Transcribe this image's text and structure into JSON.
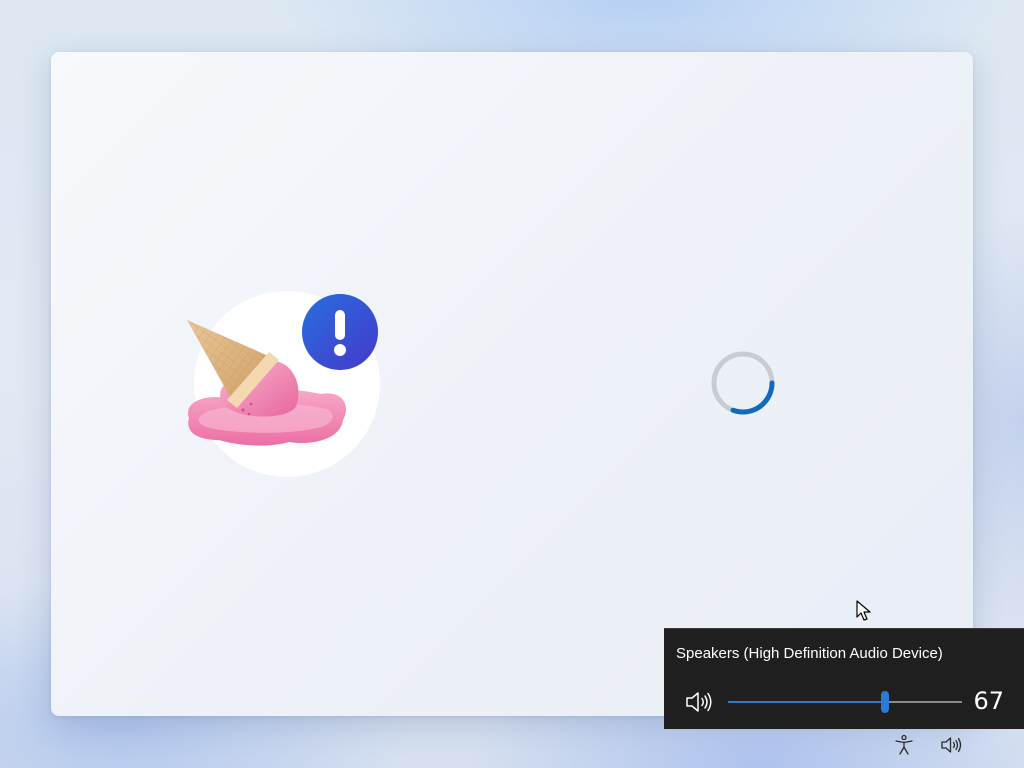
{
  "flyout": {
    "device_name": "Speakers (High Definition Audio Device)",
    "volume_value": "67",
    "volume_level": 0.67,
    "speaker_icon": "speaker-volume-icon"
  },
  "tray": {
    "icons": [
      "accessibility-icon",
      "volume-icon"
    ]
  },
  "illustration": {
    "icon": "melted-ice-cream-error-icon",
    "badge_icon": "exclamation-icon",
    "badge_color": "#3b4fd8"
  },
  "spinner": {
    "icon": "loading-spinner-icon",
    "accent": "#0f6cbd"
  }
}
